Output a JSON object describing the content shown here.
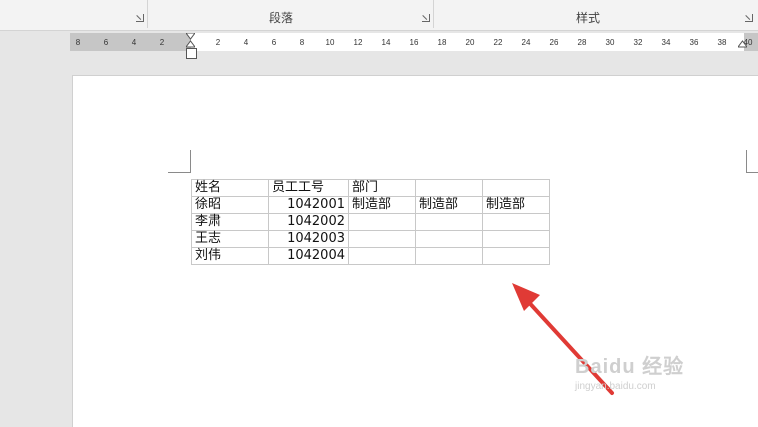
{
  "ribbon": {
    "group_paragraph": "段落",
    "group_styles": "样式"
  },
  "ruler": {
    "left_ticks": [
      "8",
      "6",
      "4",
      "2"
    ],
    "right_ticks": [
      "2",
      "4",
      "6",
      "8",
      "10",
      "12",
      "14",
      "16",
      "18",
      "20",
      "22",
      "24",
      "26",
      "28",
      "30",
      "32",
      "34",
      "36",
      "38",
      "40"
    ]
  },
  "table": {
    "header": [
      "姓名",
      "员工工号",
      "部门",
      "",
      ""
    ],
    "rows": [
      [
        "徐昭",
        "1042001",
        "制造部",
        "制造部",
        "制造部"
      ],
      [
        "李肃",
        "1042002",
        "",
        "",
        ""
      ],
      [
        "王志",
        "1042003",
        "",
        "",
        ""
      ],
      [
        "刘伟",
        "1042004",
        "",
        "",
        ""
      ]
    ]
  },
  "annotation": {
    "arrow_color": "#e03a35"
  },
  "watermark": {
    "brand": "Baidu 经验",
    "url": "jingyan.baidu.com"
  }
}
